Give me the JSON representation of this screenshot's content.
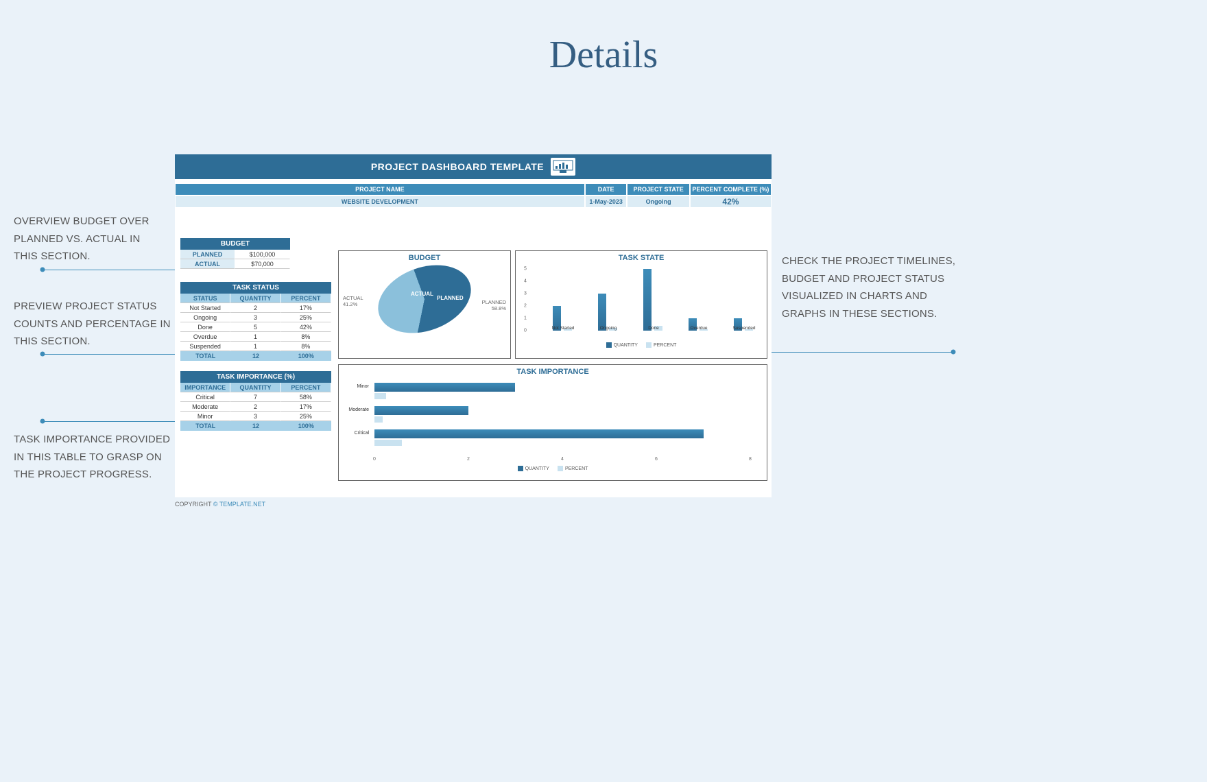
{
  "page_title": "Details",
  "header": "PROJECT DASHBOARD TEMPLATE",
  "info": {
    "labels": {
      "name": "PROJECT NAME",
      "date": "DATE",
      "state": "PROJECT STATE",
      "pct": "PERCENT COMPLETE (%)"
    },
    "values": {
      "name": "WEBSITE DEVELOPMENT",
      "date": "1-May-2023",
      "state": "Ongoing",
      "pct": "42%"
    }
  },
  "budget_table": {
    "title": "BUDGET",
    "rows": [
      {
        "label": "PLANNED",
        "value": "$100,000"
      },
      {
        "label": "ACTUAL",
        "value": "$70,000"
      }
    ]
  },
  "task_status_table": {
    "title": "TASK STATUS",
    "headers": [
      "STATUS",
      "QUANTITY",
      "PERCENT"
    ],
    "rows": [
      [
        "Not Started",
        "2",
        "17%"
      ],
      [
        "Ongoing",
        "3",
        "25%"
      ],
      [
        "Done",
        "5",
        "42%"
      ],
      [
        "Overdue",
        "1",
        "8%"
      ],
      [
        "Suspended",
        "1",
        "8%"
      ]
    ],
    "total": [
      "TOTAL",
      "12",
      "100%"
    ]
  },
  "task_importance_table": {
    "title": "TASK IMPORTANCE (%)",
    "headers": [
      "IMPORTANCE",
      "QUANTITY",
      "PERCENT"
    ],
    "rows": [
      [
        "Critical",
        "7",
        "58%"
      ],
      [
        "Moderate",
        "2",
        "17%"
      ],
      [
        "Minor",
        "3",
        "25%"
      ]
    ],
    "total": [
      "TOTAL",
      "12",
      "100%"
    ]
  },
  "chart_data": [
    {
      "id": "budget_pie",
      "type": "pie",
      "title": "BUDGET",
      "series": [
        {
          "name": "PLANNED",
          "value": 58.8
        },
        {
          "name": "ACTUAL",
          "value": 41.2
        }
      ],
      "labels": {
        "planned": "PLANNED\n58.8%",
        "actual": "ACTUAL\n41.2%"
      }
    },
    {
      "id": "task_state_bar",
      "type": "bar",
      "title": "TASK STATE",
      "categories": [
        "Not Started",
        "Ongoing",
        "Done",
        "Overdue",
        "Suspended"
      ],
      "series": [
        {
          "name": "QUANTITY",
          "values": [
            2,
            3,
            5,
            1,
            1
          ]
        },
        {
          "name": "PERCENT",
          "values": [
            0.17,
            0.25,
            0.42,
            0.08,
            0.08
          ]
        }
      ],
      "ylim": [
        0,
        5
      ],
      "yticks": [
        0,
        1,
        2,
        3,
        4,
        5
      ]
    },
    {
      "id": "task_importance_bar",
      "type": "bar_horizontal",
      "title": "TASK IMPORTANCE",
      "categories": [
        "Minor",
        "Moderate",
        "Critical"
      ],
      "series": [
        {
          "name": "QUANTITY",
          "values": [
            3,
            2,
            7
          ]
        },
        {
          "name": "PERCENT",
          "values": [
            0.25,
            0.17,
            0.58
          ]
        }
      ],
      "xlim": [
        0,
        8
      ],
      "xticks": [
        0,
        2,
        4,
        6,
        8
      ]
    }
  ],
  "legend": {
    "q": "QUANTITY",
    "p": "PERCENT"
  },
  "callouts": {
    "c1": "OVERVIEW BUDGET OVER PLANNED VS. ACTUAL IN THIS SECTION.",
    "c2": "PREVIEW PROJECT STATUS COUNTS AND PERCENTAGE IN THIS SECTION.",
    "c3": "TASK IMPORTANCE PROVIDED IN THIS TABLE TO GRASP ON THE PROJECT PROGRESS.",
    "c4": "CHECK THE PROJECT TIMELINES, BUDGET AND PROJECT STATUS VISUALIZED IN CHARTS AND GRAPHS IN THESE SECTIONS."
  },
  "copyright": {
    "pre": "COPYRIGHT ",
    "link": "© TEMPLATE.NET"
  }
}
